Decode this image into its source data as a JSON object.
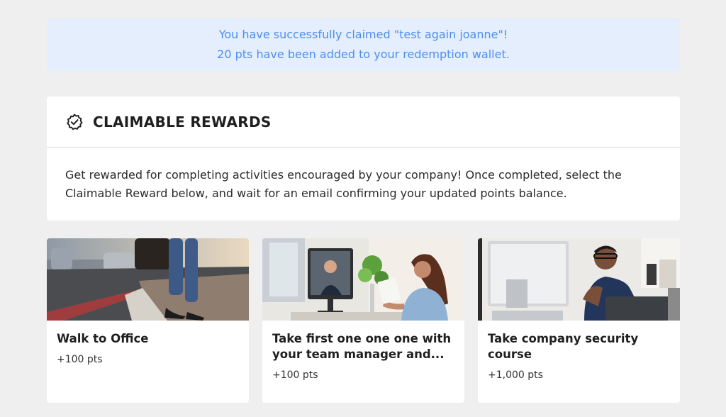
{
  "banner": {
    "line1": "You have successfully claimed \"test again joanne\"!",
    "line2": "20 pts have been added to your redemption wallet."
  },
  "rewards_panel": {
    "icon": "badge-check-icon",
    "title": "CLAIMABLE REWARDS",
    "description_line1": "Get rewarded for completing activities encouraged by your company! Once completed, select the",
    "description_line2": "Claimable Reward below, and wait for an email confirming your updated points balance."
  },
  "cards": [
    {
      "title": "Walk to Office",
      "points": "+100 pts"
    },
    {
      "title": "Take first one one one with your team manager and...",
      "title_line1": "Take first one one one with",
      "title_line2": "your team manager and...",
      "points": "+100 pts"
    },
    {
      "title": "Take company security course",
      "title_line1": "Take company security",
      "title_line2": "course",
      "points": "+1,000 pts"
    }
  ],
  "colors": {
    "page_bg": "#efefef",
    "banner_bg": "#e4eefc",
    "banner_text": "#4d8ef0",
    "card_bg": "#ffffff"
  }
}
